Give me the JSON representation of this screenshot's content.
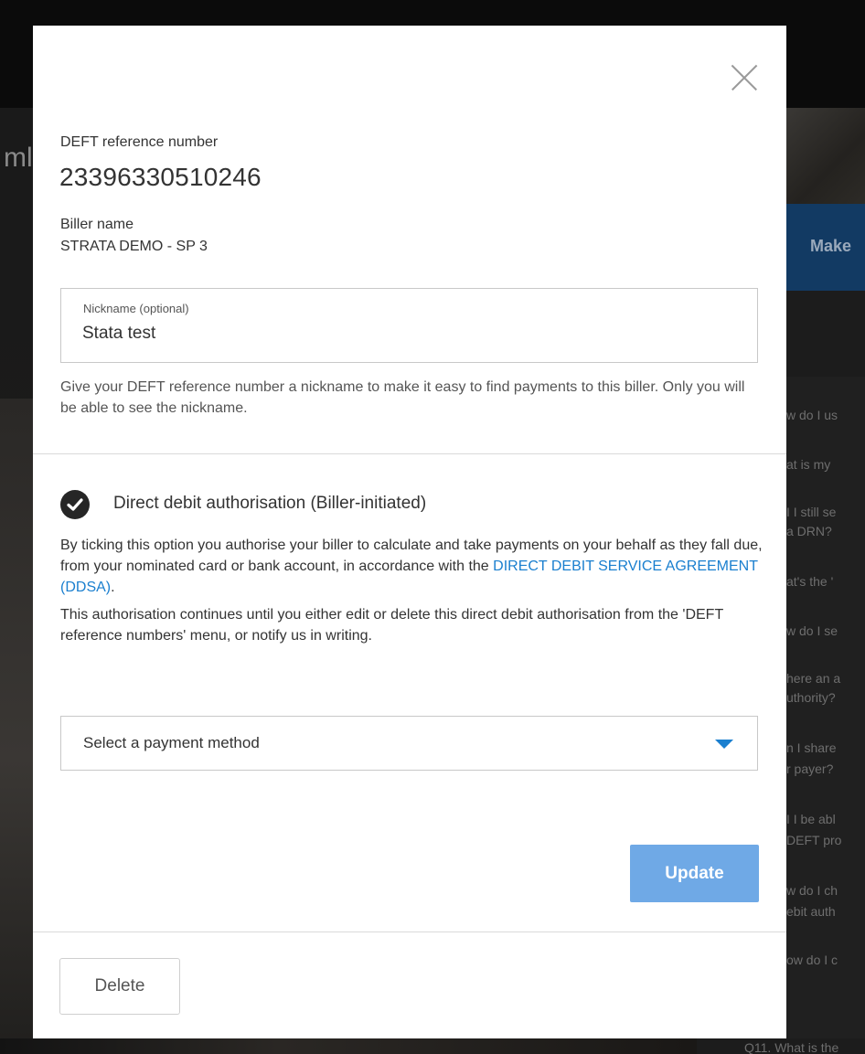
{
  "background": {
    "hero_title_fragment": "ml",
    "make_button_fragment": "Make",
    "faq_fragments": [
      "w do I us",
      "at is my",
      "I I still se",
      "a DRN?",
      "at's the '",
      "w do I se",
      "here an a",
      "uthority?",
      "n I share",
      "r payer?",
      "I I be abl",
      "DEFT pro",
      "w do I ch",
      "ebit auth",
      "ow do I c"
    ],
    "faq_bottom_fragment": "Q11. What is the"
  },
  "modal": {
    "reference": {
      "label": "DEFT reference number",
      "value": "23396330510246"
    },
    "biller": {
      "label": "Biller name",
      "value": "STRATA DEMO - SP 3"
    },
    "nickname": {
      "label": "Nickname (optional)",
      "value": "Stata test",
      "help": "Give your DEFT reference number a nickname to make it easy to find payments to this biller. Only you will be able to see the nickname."
    },
    "direct_debit": {
      "checked": true,
      "title": "Direct debit authorisation (Biller-initiated)",
      "text_before_link": "By ticking this option you authorise your biller to calculate and take payments on your behalf as they fall due, from your nominated card or bank account, in accordance with the ",
      "link_text": "DIRECT DEBIT SERVICE AGREEMENT (DDSA)",
      "text_after_link": ".",
      "continuation_text": "This authorisation continues until you either edit or delete this direct debit authorisation from the 'DEFT reference numbers' menu, or notify us in writing."
    },
    "payment_method": {
      "placeholder": "Select a payment method"
    },
    "buttons": {
      "update": "Update",
      "delete": "Delete",
      "close_icon": "close-icon"
    },
    "colors": {
      "link": "#1a7fcf",
      "update_button": "#6fa9e6",
      "check": "#262626"
    }
  }
}
